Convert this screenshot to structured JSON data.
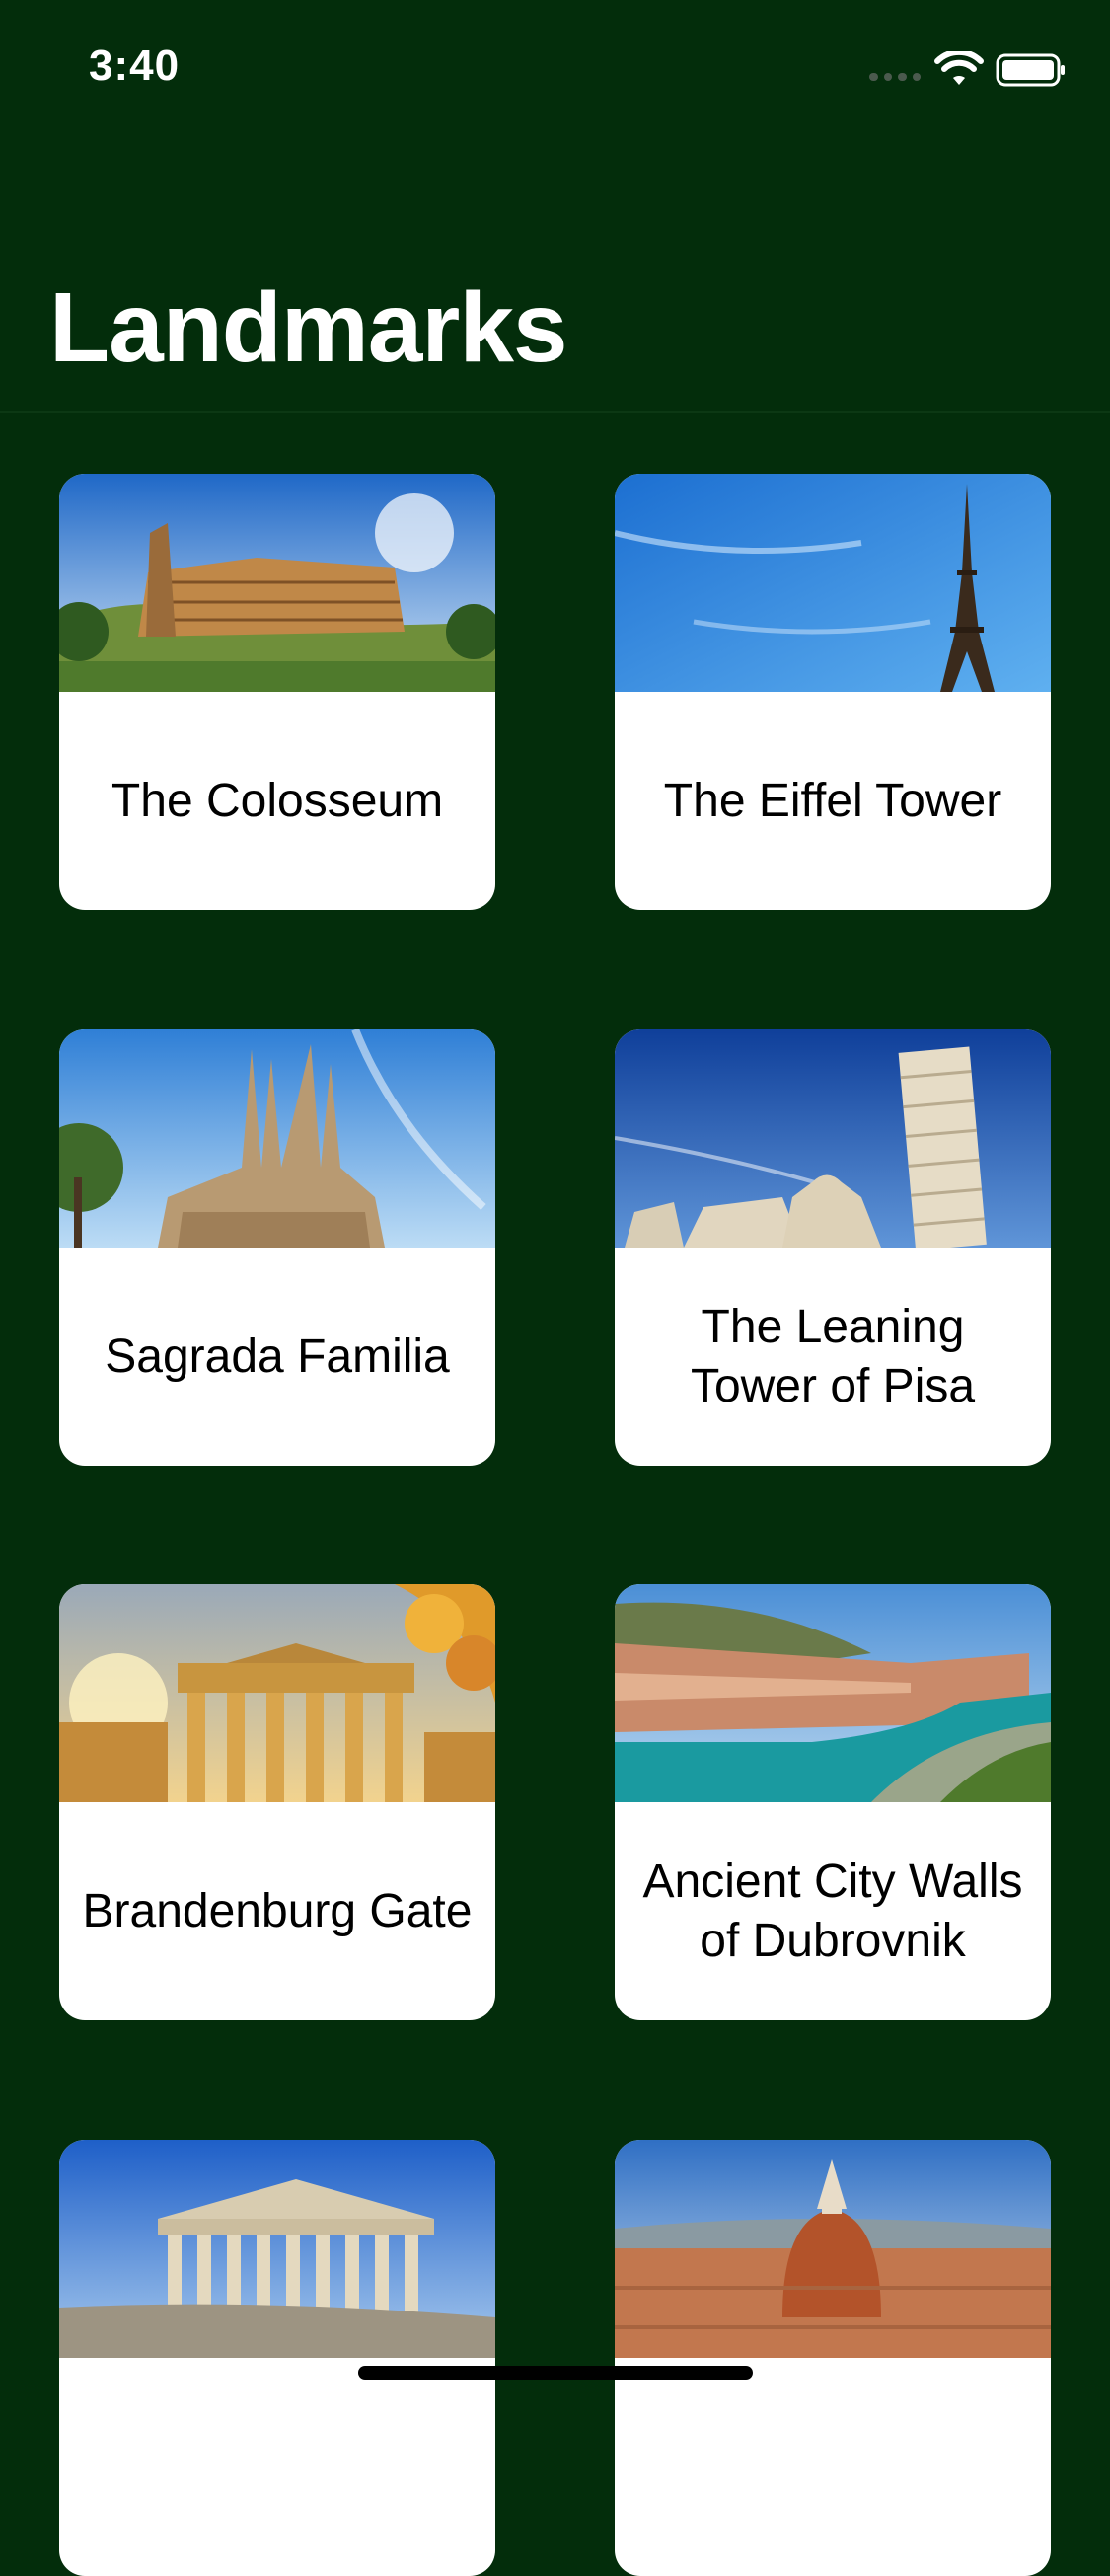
{
  "status_bar": {
    "time": "3:40",
    "icons": [
      "signal-icon",
      "wifi-icon",
      "battery-icon"
    ]
  },
  "nav": {
    "title": "Landmarks"
  },
  "colors": {
    "background": "#032d0b",
    "card": "#ffffff",
    "title_text": "#ffffff",
    "card_text": "#000000"
  },
  "landmarks": [
    {
      "name": "The Colosseum"
    },
    {
      "name": "The Eiffel Tower"
    },
    {
      "name": "Sagrada Familia"
    },
    {
      "name": "The Leaning Tower of Pisa"
    },
    {
      "name": "Brandenburg Gate"
    },
    {
      "name": "Ancient City Walls of Dubrovnik"
    },
    {
      "name": ""
    },
    {
      "name": ""
    }
  ]
}
